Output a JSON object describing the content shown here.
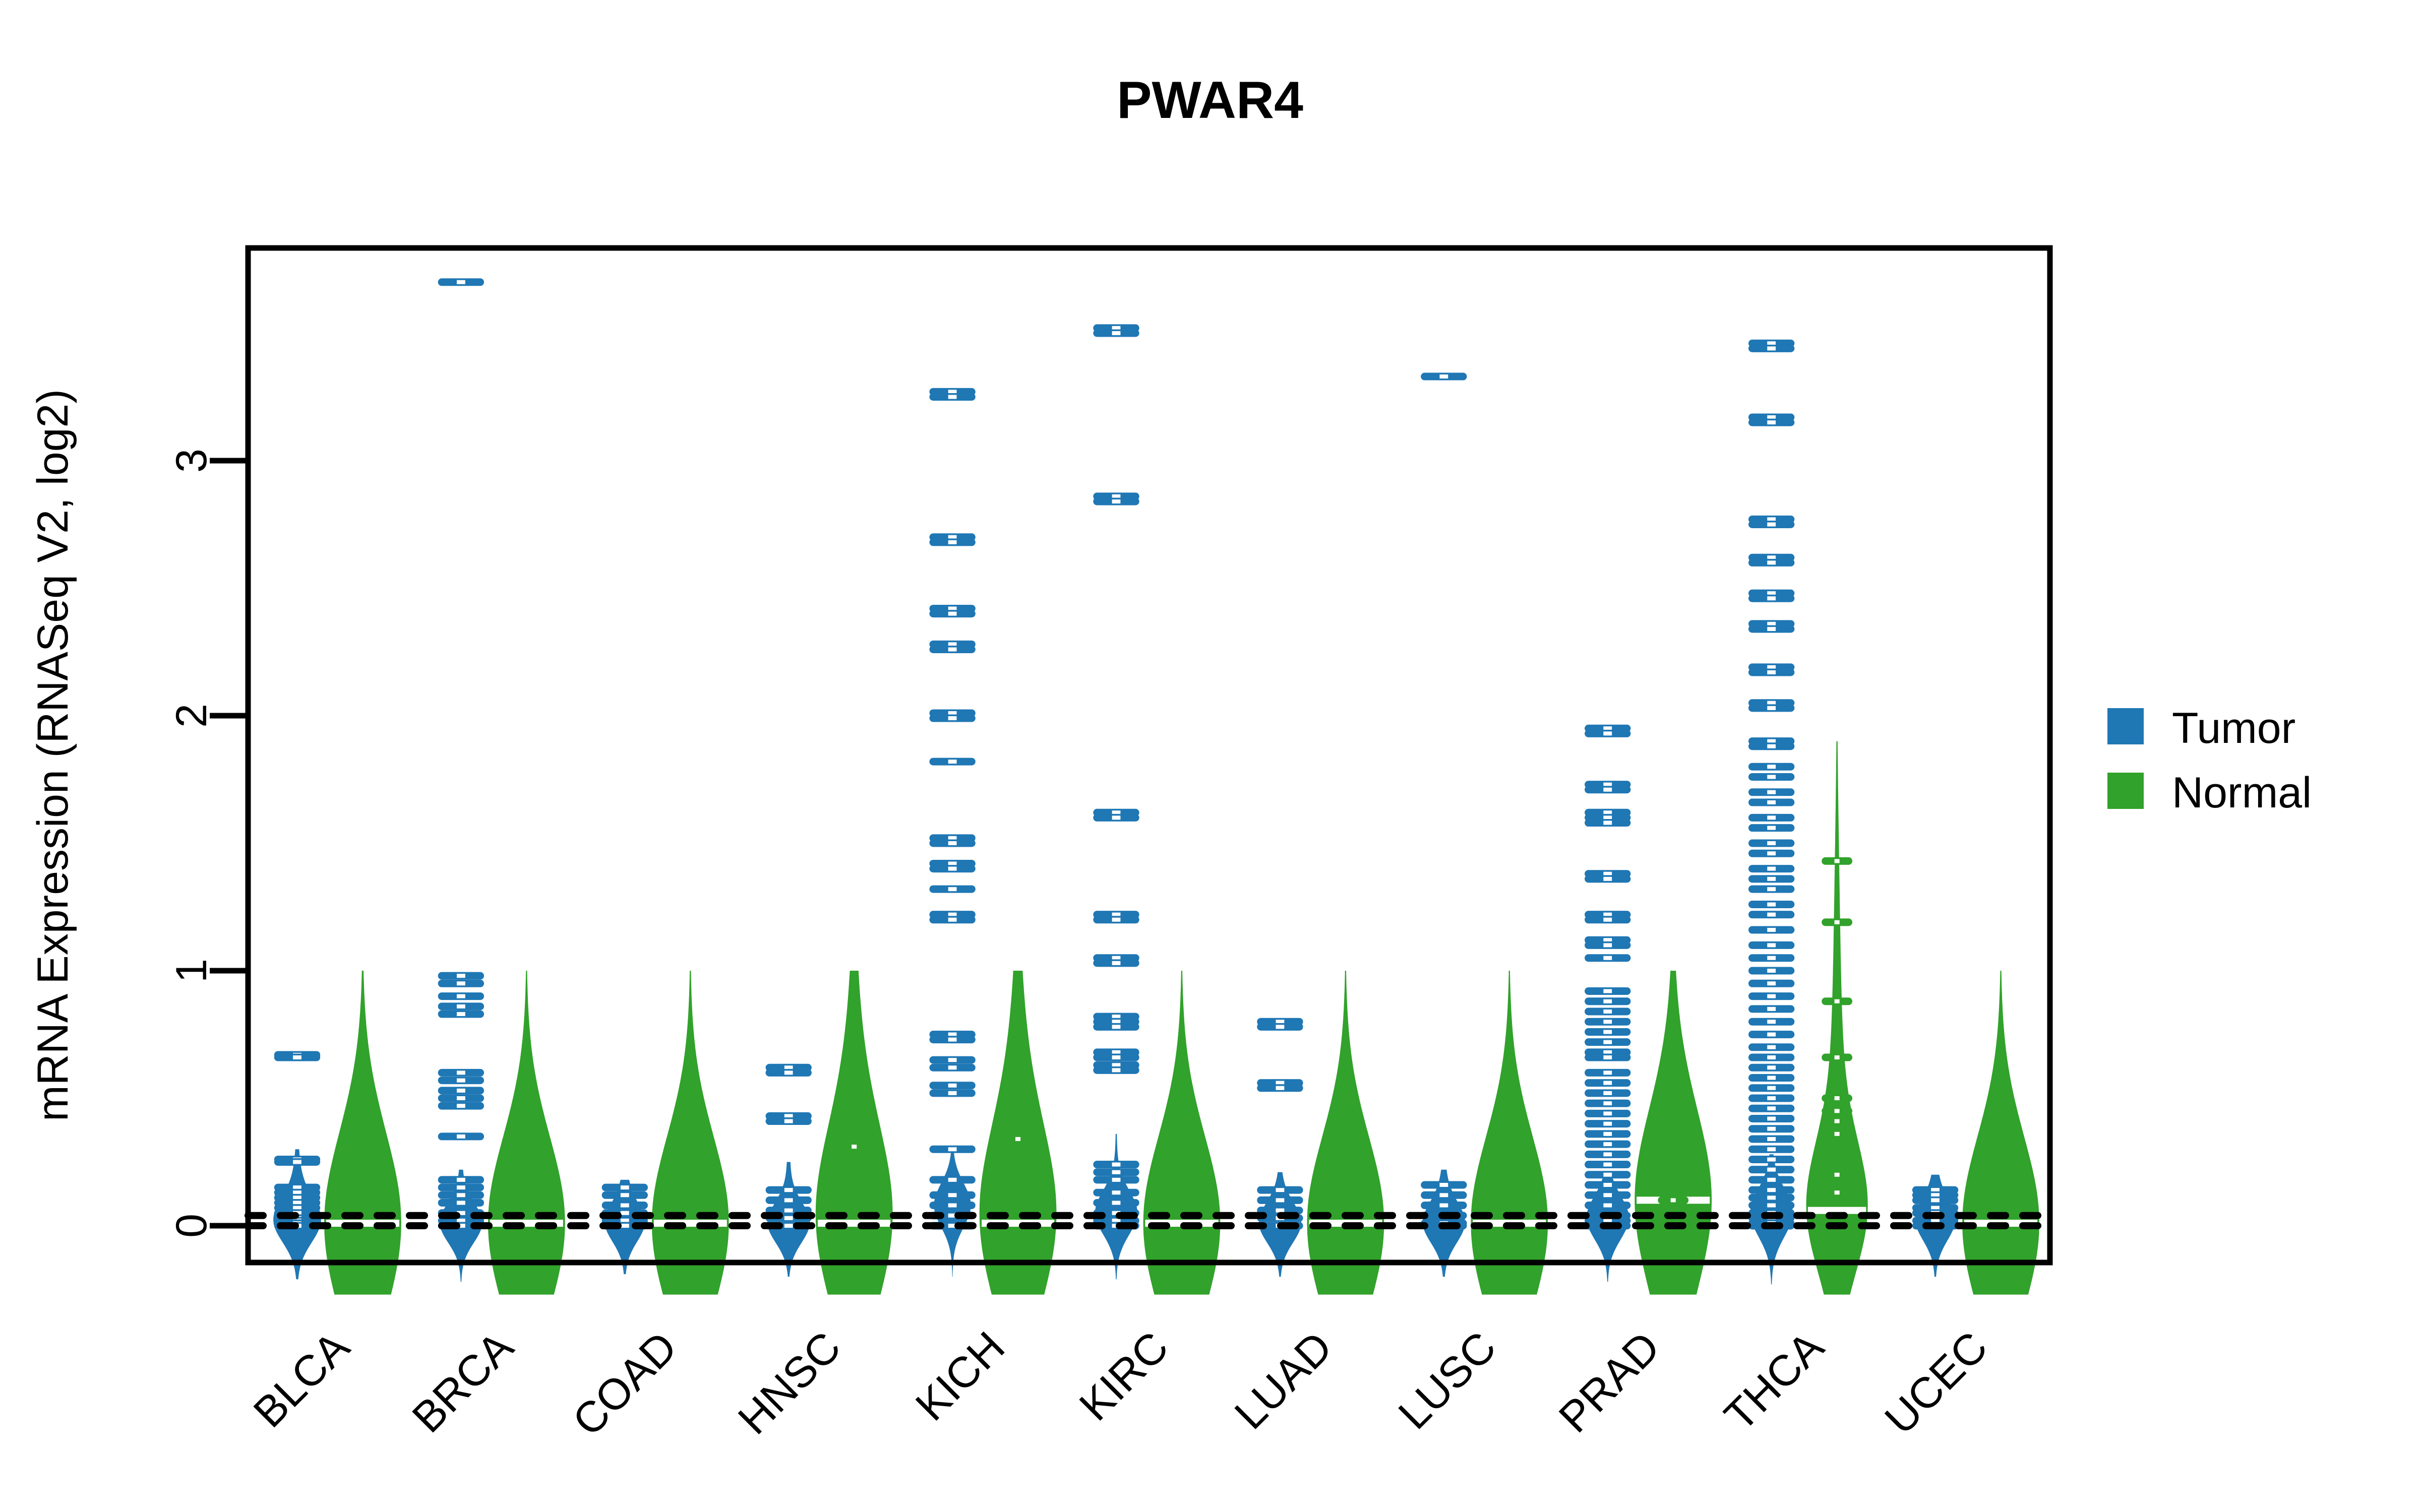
{
  "chart_data": {
    "type": "violin",
    "title": "PWAR4",
    "xlabel": "",
    "ylabel": "mRNA Expression (RNASeq V2, log2)",
    "ylim": [
      -0.28,
      3.95
    ],
    "yticks": [
      0,
      1,
      2,
      3
    ],
    "ytick_labels": [
      "0",
      "1",
      "2",
      "3"
    ],
    "grid": false,
    "legend_position": "right",
    "legend": [
      {
        "name": "Tumor",
        "color": "#1f77b4"
      },
      {
        "name": "Normal",
        "color": "#31a22b"
      }
    ],
    "reference_lines": [
      {
        "value": 0.04,
        "style": "dotted",
        "color": "#000000"
      },
      {
        "value": 0.0,
        "style": "dotted",
        "color": "#000000"
      }
    ],
    "categories": [
      "BLCA",
      "BRCA",
      "COAD",
      "HNSC",
      "KICH",
      "KIRC",
      "LUAD",
      "LUSC",
      "PRAD",
      "THCA",
      "UCEC"
    ],
    "series": [
      {
        "name": "Tumor",
        "color": "#1f77b4",
        "groups": [
          {
            "category": "BLCA",
            "median": 0.02,
            "top": 0.3,
            "bottom": -0.21,
            "width": 0.62,
            "spread": 0.1,
            "points": [
              0.67,
              0.66,
              0.26,
              0.25,
              0.15,
              0.13,
              0.11,
              0.09,
              0.07,
              0.05,
              0.03,
              0.02,
              0.01,
              0.0
            ]
          },
          {
            "category": "BRCA",
            "median": 0.01,
            "top": 0.22,
            "bottom": -0.22,
            "width": 0.55,
            "spread": 0.09,
            "points": [
              3.7,
              0.98,
              0.95,
              0.9,
              0.86,
              0.83,
              0.6,
              0.57,
              0.53,
              0.5,
              0.47,
              0.35,
              0.18,
              0.15,
              0.12,
              0.09,
              0.05,
              0.02,
              0.0
            ]
          },
          {
            "category": "COAD",
            "median": 0.01,
            "top": 0.18,
            "bottom": -0.19,
            "width": 0.52,
            "spread": 0.085,
            "points": [
              0.15,
              0.12,
              0.08,
              0.05,
              0.02,
              0.0
            ]
          },
          {
            "category": "HNSC",
            "median": 0.01,
            "top": 0.25,
            "bottom": -0.2,
            "width": 0.55,
            "spread": 0.09,
            "points": [
              0.62,
              0.6,
              0.43,
              0.41,
              0.14,
              0.1,
              0.06,
              0.03,
              0.0
            ]
          },
          {
            "category": "KICH",
            "median": 0.08,
            "top": 0.3,
            "bottom": -0.2,
            "width": 0.48,
            "spread": 0.1,
            "points": [
              3.27,
              3.25,
              2.7,
              2.68,
              2.42,
              2.4,
              2.28,
              2.26,
              2.01,
              1.99,
              1.82,
              1.52,
              1.5,
              1.42,
              1.4,
              1.32,
              1.22,
              1.2,
              0.75,
              0.73,
              0.65,
              0.62,
              0.55,
              0.52,
              0.3,
              0.18,
              0.12,
              0.08,
              0.04,
              0.0
            ]
          },
          {
            "category": "KIRC",
            "median": 0.05,
            "top": 0.36,
            "bottom": -0.21,
            "width": 0.55,
            "spread": 0.1,
            "points": [
              3.52,
              3.5,
              2.86,
              2.84,
              1.62,
              1.6,
              1.22,
              1.2,
              1.05,
              1.03,
              0.82,
              0.8,
              0.78,
              0.68,
              0.66,
              0.63,
              0.61,
              0.24,
              0.21,
              0.18,
              0.13,
              0.09,
              0.05,
              0.02,
              0.0
            ]
          },
          {
            "category": "LUAD",
            "median": 0.01,
            "top": 0.21,
            "bottom": -0.2,
            "width": 0.55,
            "spread": 0.09,
            "points": [
              0.8,
              0.78,
              0.56,
              0.54,
              0.14,
              0.1,
              0.06,
              0.03,
              0.0
            ]
          },
          {
            "category": "LUSC",
            "median": 0.01,
            "top": 0.22,
            "bottom": -0.2,
            "width": 0.55,
            "spread": 0.09,
            "points": [
              3.33,
              0.16,
              0.12,
              0.08,
              0.04,
              0.01,
              0.0
            ]
          },
          {
            "category": "PRAD",
            "median": 0.03,
            "top": 0.2,
            "bottom": -0.22,
            "width": 0.55,
            "spread": 0.1,
            "points": [
              1.95,
              1.93,
              1.73,
              1.71,
              1.62,
              1.6,
              1.58,
              1.38,
              1.36,
              1.22,
              1.2,
              1.12,
              1.1,
              1.05,
              0.92,
              0.88,
              0.84,
              0.8,
              0.76,
              0.72,
              0.68,
              0.66,
              0.6,
              0.56,
              0.52,
              0.48,
              0.44,
              0.4,
              0.36,
              0.32,
              0.28,
              0.24,
              0.2,
              0.16,
              0.12,
              0.08,
              0.04,
              0.02,
              0.0
            ]
          },
          {
            "category": "THCA",
            "median": 0.05,
            "top": 0.28,
            "bottom": -0.23,
            "width": 0.55,
            "spread": 0.11,
            "points": [
              3.46,
              3.44,
              3.17,
              3.15,
              2.77,
              2.75,
              2.62,
              2.6,
              2.48,
              2.46,
              2.36,
              2.34,
              2.19,
              2.17,
              2.05,
              2.03,
              1.9,
              1.88,
              1.8,
              1.76,
              1.7,
              1.66,
              1.6,
              1.56,
              1.5,
              1.46,
              1.4,
              1.36,
              1.32,
              1.26,
              1.22,
              1.16,
              1.1,
              1.05,
              1.0,
              0.95,
              0.9,
              0.85,
              0.8,
              0.75,
              0.7,
              0.66,
              0.62,
              0.58,
              0.54,
              0.5,
              0.46,
              0.42,
              0.38,
              0.34,
              0.3,
              0.26,
              0.22,
              0.18,
              0.14,
              0.11,
              0.08,
              0.05,
              0.03,
              0.01,
              0.0
            ]
          },
          {
            "category": "UCEC",
            "median": 0.02,
            "top": 0.2,
            "bottom": -0.2,
            "width": 0.52,
            "spread": 0.09,
            "points": [
              0.14,
              0.12,
              0.1,
              0.07,
              0.05,
              0.02,
              0.0
            ]
          }
        ]
      },
      {
        "name": "Normal",
        "color": "#31a22b",
        "groups": [
          {
            "category": "BLCA",
            "median": 0.01,
            "top": 1.0,
            "bottom": -0.27,
            "width": 1.0,
            "spread": 0.42,
            "points": []
          },
          {
            "category": "BRCA",
            "median": 0.01,
            "top": 1.0,
            "bottom": -0.27,
            "width": 1.0,
            "spread": 0.4,
            "points": []
          },
          {
            "category": "COAD",
            "median": 0.01,
            "top": 1.0,
            "bottom": -0.27,
            "width": 1.0,
            "spread": 0.4,
            "points": []
          },
          {
            "category": "HNSC",
            "median": 0.01,
            "top": 1.0,
            "bottom": -0.27,
            "width": 1.0,
            "spread": 0.4,
            "points": [
              0.31
            ]
          },
          {
            "category": "KICH",
            "median": 0.01,
            "top": 1.0,
            "bottom": -0.27,
            "width": 1.0,
            "spread": 0.4,
            "points": [
              0.34
            ]
          },
          {
            "category": "KIRC",
            "median": 0.01,
            "top": 1.0,
            "bottom": -0.27,
            "width": 1.0,
            "spread": 0.4,
            "points": []
          },
          {
            "category": "LUAD",
            "median": 0.01,
            "top": 1.0,
            "bottom": -0.27,
            "width": 1.0,
            "spread": 0.4,
            "points": []
          },
          {
            "category": "LUSC",
            "median": 0.01,
            "top": 1.0,
            "bottom": -0.27,
            "width": 1.0,
            "spread": 0.4,
            "points": []
          },
          {
            "category": "PRAD",
            "median": 0.1,
            "top": 1.0,
            "bottom": -0.27,
            "width": 1.0,
            "spread": 0.4,
            "points": [
              0.1
            ]
          },
          {
            "category": "THCA",
            "median": 0.06,
            "top": 1.9,
            "bottom": -0.27,
            "width": 0.8,
            "spread": 0.3,
            "points": [
              1.43,
              1.19,
              0.88,
              0.66,
              0.5,
              0.45,
              0.41,
              0.36,
              0.2,
              0.13
            ]
          },
          {
            "category": "UCEC",
            "median": 0.01,
            "top": 1.0,
            "bottom": -0.27,
            "width": 1.0,
            "spread": 0.4,
            "points": []
          }
        ]
      }
    ]
  }
}
